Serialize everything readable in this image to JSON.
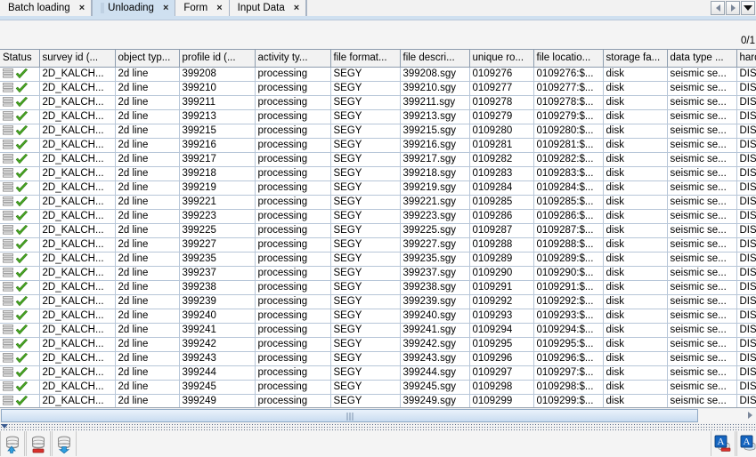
{
  "window": {
    "counter": "0/1"
  },
  "tabs": [
    {
      "label": "Batch loading",
      "close": "×",
      "active": false
    },
    {
      "label": "Unloading",
      "close": "×",
      "active": true
    },
    {
      "label": "Form",
      "close": "×",
      "active": false
    },
    {
      "label": "Input Data",
      "close": "×",
      "active": false
    }
  ],
  "nav": {
    "prev_icon": "triangle-left-icon",
    "next_icon": "triangle-right-icon",
    "menu_icon": "chevron-down-icon"
  },
  "table": {
    "columns": [
      "Status",
      "survey id (...",
      "object typ...",
      "profile id (...",
      "activity ty...",
      "file format...",
      "file descri...",
      "unique ro...",
      "file locatio...",
      "storage fa...",
      "data type ...",
      "hardcopy"
    ],
    "rows": [
      {
        "status": "ok",
        "survey_id": "2D_KALCH...",
        "object_type": "2d line",
        "profile_id": "399208",
        "activity_type": "processing",
        "file_format": "SEGY",
        "file_description": "399208.sgy",
        "unique_row": "0109276",
        "file_location": "0109276:$...",
        "storage_facility": "disk",
        "data_type": "seismic se...",
        "hardcopy": "DISK"
      },
      {
        "status": "ok",
        "survey_id": "2D_KALCH...",
        "object_type": "2d line",
        "profile_id": "399210",
        "activity_type": "processing",
        "file_format": "SEGY",
        "file_description": "399210.sgy",
        "unique_row": "0109277",
        "file_location": "0109277:$...",
        "storage_facility": "disk",
        "data_type": "seismic se...",
        "hardcopy": "DISK"
      },
      {
        "status": "ok",
        "survey_id": "2D_KALCH...",
        "object_type": "2d line",
        "profile_id": "399211",
        "activity_type": "processing",
        "file_format": "SEGY",
        "file_description": "399211.sgy",
        "unique_row": "0109278",
        "file_location": "0109278:$...",
        "storage_facility": "disk",
        "data_type": "seismic se...",
        "hardcopy": "DISK"
      },
      {
        "status": "ok",
        "survey_id": "2D_KALCH...",
        "object_type": "2d line",
        "profile_id": "399213",
        "activity_type": "processing",
        "file_format": "SEGY",
        "file_description": "399213.sgy",
        "unique_row": "0109279",
        "file_location": "0109279:$...",
        "storage_facility": "disk",
        "data_type": "seismic se...",
        "hardcopy": "DISK"
      },
      {
        "status": "ok",
        "survey_id": "2D_KALCH...",
        "object_type": "2d line",
        "profile_id": "399215",
        "activity_type": "processing",
        "file_format": "SEGY",
        "file_description": "399215.sgy",
        "unique_row": "0109280",
        "file_location": "0109280:$...",
        "storage_facility": "disk",
        "data_type": "seismic se...",
        "hardcopy": "DISK"
      },
      {
        "status": "ok",
        "survey_id": "2D_KALCH...",
        "object_type": "2d line",
        "profile_id": "399216",
        "activity_type": "processing",
        "file_format": "SEGY",
        "file_description": "399216.sgy",
        "unique_row": "0109281",
        "file_location": "0109281:$...",
        "storage_facility": "disk",
        "data_type": "seismic se...",
        "hardcopy": "DISK"
      },
      {
        "status": "ok",
        "survey_id": "2D_KALCH...",
        "object_type": "2d line",
        "profile_id": "399217",
        "activity_type": "processing",
        "file_format": "SEGY",
        "file_description": "399217.sgy",
        "unique_row": "0109282",
        "file_location": "0109282:$...",
        "storage_facility": "disk",
        "data_type": "seismic se...",
        "hardcopy": "DISK"
      },
      {
        "status": "ok",
        "survey_id": "2D_KALCH...",
        "object_type": "2d line",
        "profile_id": "399218",
        "activity_type": "processing",
        "file_format": "SEGY",
        "file_description": "399218.sgy",
        "unique_row": "0109283",
        "file_location": "0109283:$...",
        "storage_facility": "disk",
        "data_type": "seismic se...",
        "hardcopy": "DISK"
      },
      {
        "status": "ok",
        "survey_id": "2D_KALCH...",
        "object_type": "2d line",
        "profile_id": "399219",
        "activity_type": "processing",
        "file_format": "SEGY",
        "file_description": "399219.sgy",
        "unique_row": "0109284",
        "file_location": "0109284:$...",
        "storage_facility": "disk",
        "data_type": "seismic se...",
        "hardcopy": "DISK"
      },
      {
        "status": "ok",
        "survey_id": "2D_KALCH...",
        "object_type": "2d line",
        "profile_id": "399221",
        "activity_type": "processing",
        "file_format": "SEGY",
        "file_description": "399221.sgy",
        "unique_row": "0109285",
        "file_location": "0109285:$...",
        "storage_facility": "disk",
        "data_type": "seismic se...",
        "hardcopy": "DISK"
      },
      {
        "status": "ok",
        "survey_id": "2D_KALCH...",
        "object_type": "2d line",
        "profile_id": "399223",
        "activity_type": "processing",
        "file_format": "SEGY",
        "file_description": "399223.sgy",
        "unique_row": "0109286",
        "file_location": "0109286:$...",
        "storage_facility": "disk",
        "data_type": "seismic se...",
        "hardcopy": "DISK"
      },
      {
        "status": "ok",
        "survey_id": "2D_KALCH...",
        "object_type": "2d line",
        "profile_id": "399225",
        "activity_type": "processing",
        "file_format": "SEGY",
        "file_description": "399225.sgy",
        "unique_row": "0109287",
        "file_location": "0109287:$...",
        "storage_facility": "disk",
        "data_type": "seismic se...",
        "hardcopy": "DISK"
      },
      {
        "status": "ok",
        "survey_id": "2D_KALCH...",
        "object_type": "2d line",
        "profile_id": "399227",
        "activity_type": "processing",
        "file_format": "SEGY",
        "file_description": "399227.sgy",
        "unique_row": "0109288",
        "file_location": "0109288:$...",
        "storage_facility": "disk",
        "data_type": "seismic se...",
        "hardcopy": "DISK"
      },
      {
        "status": "ok",
        "survey_id": "2D_KALCH...",
        "object_type": "2d line",
        "profile_id": "399235",
        "activity_type": "processing",
        "file_format": "SEGY",
        "file_description": "399235.sgy",
        "unique_row": "0109289",
        "file_location": "0109289:$...",
        "storage_facility": "disk",
        "data_type": "seismic se...",
        "hardcopy": "DISK"
      },
      {
        "status": "ok",
        "survey_id": "2D_KALCH...",
        "object_type": "2d line",
        "profile_id": "399237",
        "activity_type": "processing",
        "file_format": "SEGY",
        "file_description": "399237.sgy",
        "unique_row": "0109290",
        "file_location": "0109290:$...",
        "storage_facility": "disk",
        "data_type": "seismic se...",
        "hardcopy": "DISK"
      },
      {
        "status": "ok",
        "survey_id": "2D_KALCH...",
        "object_type": "2d line",
        "profile_id": "399238",
        "activity_type": "processing",
        "file_format": "SEGY",
        "file_description": "399238.sgy",
        "unique_row": "0109291",
        "file_location": "0109291:$...",
        "storage_facility": "disk",
        "data_type": "seismic se...",
        "hardcopy": "DISK"
      },
      {
        "status": "ok",
        "survey_id": "2D_KALCH...",
        "object_type": "2d line",
        "profile_id": "399239",
        "activity_type": "processing",
        "file_format": "SEGY",
        "file_description": "399239.sgy",
        "unique_row": "0109292",
        "file_location": "0109292:$...",
        "storage_facility": "disk",
        "data_type": "seismic se...",
        "hardcopy": "DISK"
      },
      {
        "status": "ok",
        "survey_id": "2D_KALCH...",
        "object_type": "2d line",
        "profile_id": "399240",
        "activity_type": "processing",
        "file_format": "SEGY",
        "file_description": "399240.sgy",
        "unique_row": "0109293",
        "file_location": "0109293:$...",
        "storage_facility": "disk",
        "data_type": "seismic se...",
        "hardcopy": "DISK"
      },
      {
        "status": "ok",
        "survey_id": "2D_KALCH...",
        "object_type": "2d line",
        "profile_id": "399241",
        "activity_type": "processing",
        "file_format": "SEGY",
        "file_description": "399241.sgy",
        "unique_row": "0109294",
        "file_location": "0109294:$...",
        "storage_facility": "disk",
        "data_type": "seismic se...",
        "hardcopy": "DISK"
      },
      {
        "status": "ok",
        "survey_id": "2D_KALCH...",
        "object_type": "2d line",
        "profile_id": "399242",
        "activity_type": "processing",
        "file_format": "SEGY",
        "file_description": "399242.sgy",
        "unique_row": "0109295",
        "file_location": "0109295:$...",
        "storage_facility": "disk",
        "data_type": "seismic se...",
        "hardcopy": "DISK"
      },
      {
        "status": "ok",
        "survey_id": "2D_KALCH...",
        "object_type": "2d line",
        "profile_id": "399243",
        "activity_type": "processing",
        "file_format": "SEGY",
        "file_description": "399243.sgy",
        "unique_row": "0109296",
        "file_location": "0109296:$...",
        "storage_facility": "disk",
        "data_type": "seismic se...",
        "hardcopy": "DISK"
      },
      {
        "status": "ok",
        "survey_id": "2D_KALCH...",
        "object_type": "2d line",
        "profile_id": "399244",
        "activity_type": "processing",
        "file_format": "SEGY",
        "file_description": "399244.sgy",
        "unique_row": "0109297",
        "file_location": "0109297:$...",
        "storage_facility": "disk",
        "data_type": "seismic se...",
        "hardcopy": "DISK"
      },
      {
        "status": "ok",
        "survey_id": "2D_KALCH...",
        "object_type": "2d line",
        "profile_id": "399245",
        "activity_type": "processing",
        "file_format": "SEGY",
        "file_description": "399245.sgy",
        "unique_row": "0109298",
        "file_location": "0109298:$...",
        "storage_facility": "disk",
        "data_type": "seismic se...",
        "hardcopy": "DISK"
      },
      {
        "status": "ok",
        "survey_id": "2D_KALCH...",
        "object_type": "2d line",
        "profile_id": "399249",
        "activity_type": "processing",
        "file_format": "SEGY",
        "file_description": "399249.sgy",
        "unique_row": "0109299",
        "file_location": "0109299:$...",
        "storage_facility": "disk",
        "data_type": "seismic se...",
        "hardcopy": "DISK"
      }
    ]
  },
  "toolbar": {
    "left_buttons": [
      {
        "icon": "database-upload-icon"
      },
      {
        "icon": "database-remove-icon"
      },
      {
        "icon": "database-download-icon"
      }
    ],
    "right_buttons": [
      {
        "icon": "annotation-remove-icon"
      },
      {
        "icon": "annotation-add-icon"
      }
    ]
  },
  "colors": {
    "accent": "#cfe0f0",
    "grid_border": "#b7c6d8",
    "header_border": "#8d9cae",
    "status_ok": "#4bac26"
  }
}
